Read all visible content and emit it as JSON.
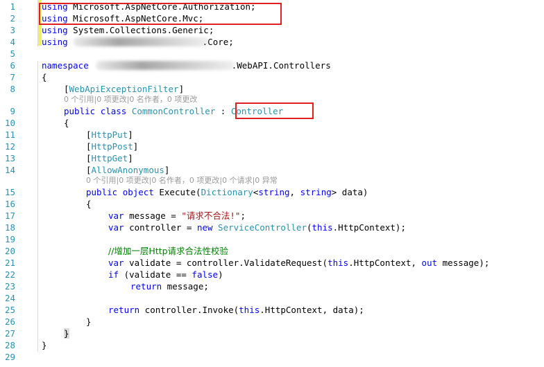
{
  "line_numbers": [
    "1",
    "2",
    "3",
    "4",
    "5",
    "6",
    "7",
    "8",
    "9",
    "10",
    "11",
    "12",
    "13",
    "14",
    "15",
    "16",
    "17",
    "18",
    "19",
    "20",
    "21",
    "22",
    "23",
    "24",
    "25",
    "26",
    "27",
    "28",
    "29"
  ],
  "code": {
    "l1": {
      "kw": "using",
      "rest": " Microsoft.AspNetCore.Authorization;"
    },
    "l2": {
      "kw": "using",
      "rest": " Microsoft.AspNetCore.Mvc;"
    },
    "l3": {
      "kw": "using",
      "rest": " System.Collections.Generic;"
    },
    "l4": {
      "kw": "using",
      "rest_tail": ".Core;"
    },
    "l6": {
      "kw": "namespace",
      "rest_tail": ".WebAPI.Controllers"
    },
    "l7": {
      "text": "{"
    },
    "l8": {
      "open": "[",
      "attr": "WebApiExceptionFilter",
      "close": "]"
    },
    "codelens1": "0 个引用|0 项更改|0 名作者，0 项更改",
    "l9": {
      "kw1": "public",
      "kw2": "class",
      "name": "CommonController",
      "colon": " : ",
      "base": "Controller"
    },
    "l10": {
      "text": "{"
    },
    "l11": {
      "open": "[",
      "attr": "HttpPut",
      "close": "]"
    },
    "l12": {
      "open": "[",
      "attr": "HttpPost",
      "close": "]"
    },
    "l13": {
      "open": "[",
      "attr": "HttpGet",
      "close": "]"
    },
    "l14": {
      "open": "[",
      "attr": "AllowAnonymous",
      "close": "]"
    },
    "codelens2": "0 个引用|0 项更改|0 名作者，0 项更改|0 个请求|0 异常",
    "l15": {
      "kw1": "public",
      "kw2": "object",
      "method": " Execute(",
      "type1": "Dictionary",
      "lt": "<",
      "kw3": "string",
      "comma": ", ",
      "kw4": "string",
      "gt": "> data)"
    },
    "l16": {
      "text": "{"
    },
    "l17": {
      "kw": "var",
      "mid": " message = ",
      "str": "\"请求不合法!\"",
      "end": ";"
    },
    "l18": {
      "kw": "var",
      "mid": " controller = ",
      "kw2": "new",
      "sp": " ",
      "type": "ServiceController",
      "open": "(",
      "this": "this",
      "end": ".HttpContext);"
    },
    "l20": {
      "comment": "//增加一层Http请求合法性校验"
    },
    "l21": {
      "kw": "var",
      "mid": " validate = controller.ValidateRequest(",
      "this": "this",
      "mid2": ".HttpContext, ",
      "kw2": "out",
      "end": " message);"
    },
    "l22": {
      "kw": "if",
      "mid": " (validate == ",
      "kw2": "false",
      "end": ")"
    },
    "l23": {
      "kw": "return",
      "end": " message;"
    },
    "l25": {
      "kw": "return",
      "mid": " controller.Invoke(",
      "this": "this",
      "end": ".HttpContext, data);"
    },
    "l26": {
      "text": "}"
    },
    "l27": {
      "text": "}"
    },
    "l28": {
      "text": "}"
    }
  }
}
